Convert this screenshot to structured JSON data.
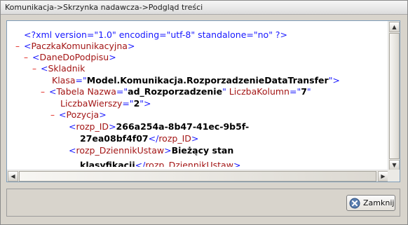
{
  "window": {
    "title": "Komunikacja->Skrzynka nadawcza->Podgląd treści"
  },
  "xml": {
    "declaration": "<?xml version=\"1.0\" encoding=\"utf-8\" standalone=\"no\" ?>",
    "collapse_symbol": "–",
    "paczka_tag": "PaczkaKomunikacyjna",
    "dane_tag": "DaneDoPodpisu",
    "skladnik_tag": "Skladnik",
    "klasa_attr": "Klasa",
    "klasa_value": "Model.Komunikacja.RozporzadzenieDataTransfer",
    "tabela_tag": "Tabela",
    "nazwa_attr": "Nazwa",
    "nazwa_value": "ad_Rozporzadzenie",
    "liczba_kolumn_attr": "LiczbaKolumn",
    "liczba_kolumn_value": "7",
    "liczba_wierszy_attr": "LiczbaWierszy",
    "liczba_wierszy_value": "2",
    "pozycja_tag": "Pozycja",
    "rozp_id_tag": "rozp_ID",
    "rozp_id_value_1": "266a254a-8b47-41ec-9b5f-",
    "rozp_id_value_2": "27ea08bf4f07",
    "dziennik_tag": "rozp_DziennikUstaw",
    "dziennik_value_1": "Bieżący stan",
    "dziennik_value_2": "klasyfikacji"
  },
  "footer": {
    "close_label": "Zamknij"
  }
}
